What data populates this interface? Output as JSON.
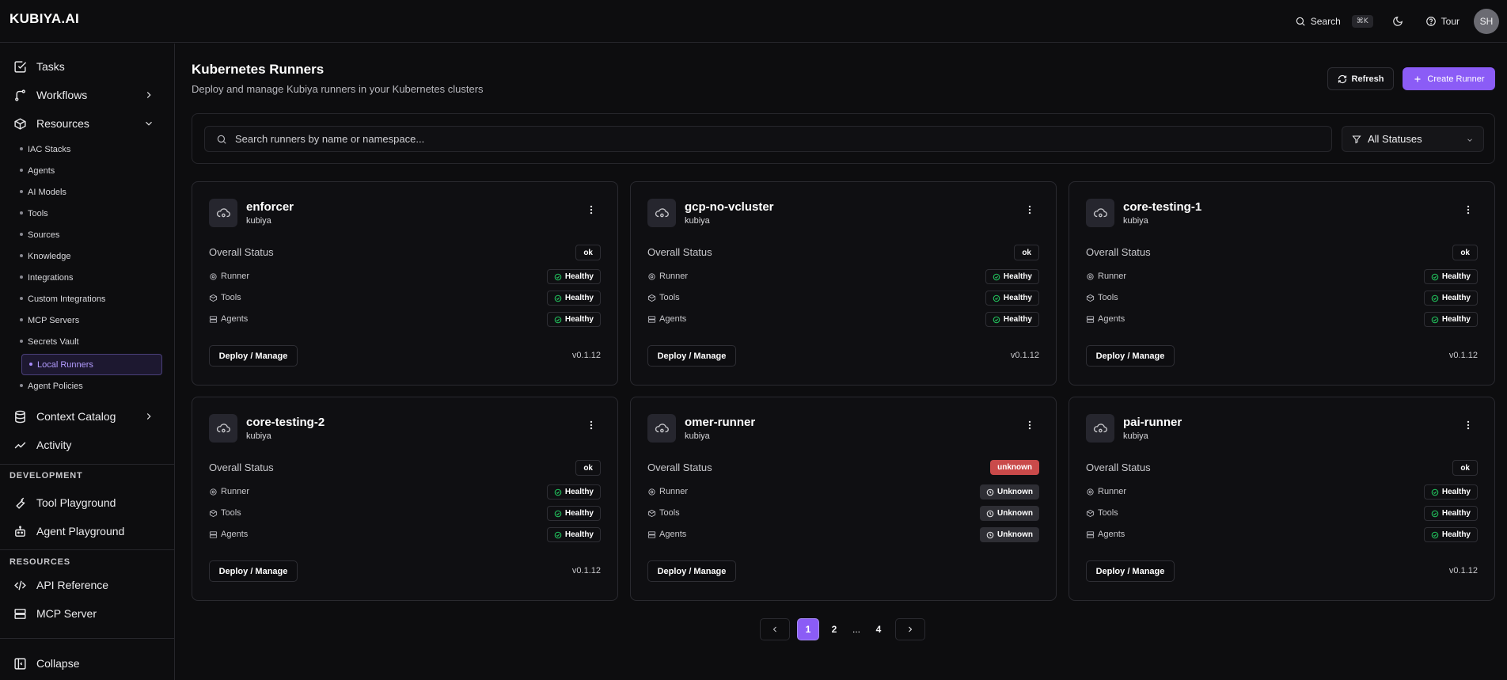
{
  "app": {
    "logo": "KUBIYA.AI",
    "search_label": "Search",
    "search_shortcut": "⌘K",
    "tour_label": "Tour",
    "avatar_initials": "SH"
  },
  "sidebar": {
    "main": [
      {
        "label": "Tasks"
      },
      {
        "label": "Workflows"
      },
      {
        "label": "Resources"
      }
    ],
    "resources_items": [
      {
        "label": "IAC Stacks"
      },
      {
        "label": "Agents"
      },
      {
        "label": "AI Models"
      },
      {
        "label": "Tools"
      },
      {
        "label": "Sources"
      },
      {
        "label": "Knowledge"
      },
      {
        "label": "Integrations"
      },
      {
        "label": "Custom Integrations"
      },
      {
        "label": "MCP Servers"
      },
      {
        "label": "Secrets Vault"
      },
      {
        "label": "Local Runners"
      },
      {
        "label": "Agent Policies"
      }
    ],
    "context_catalog": "Context Catalog",
    "activity": "Activity",
    "development_label": "DEVELOPMENT",
    "tool_playground": "Tool Playground",
    "agent_playground": "Agent Playground",
    "resources_label": "RESOURCES",
    "api_reference": "API Reference",
    "mcp_server": "MCP Server",
    "collapse": "Collapse"
  },
  "header": {
    "title": "Kubernetes Runners",
    "subtitle": "Deploy and manage Kubiya runners in your Kubernetes clusters",
    "refresh_label": "Refresh",
    "create_label": "Create Runner"
  },
  "filters": {
    "search_placeholder": "Search runners by name or namespace...",
    "status_selected": "All Statuses"
  },
  "labels": {
    "overall_status": "Overall Status",
    "runner": "Runner",
    "tools": "Tools",
    "agents": "Agents",
    "deploy": "Deploy / Manage"
  },
  "runners": [
    {
      "name": "enforcer",
      "namespace": "kubiya",
      "overall": "ok",
      "runner": "Healthy",
      "tools": "Healthy",
      "agents": "Healthy",
      "version": "v0.1.12"
    },
    {
      "name": "gcp-no-vcluster",
      "namespace": "kubiya",
      "overall": "ok",
      "runner": "Healthy",
      "tools": "Healthy",
      "agents": "Healthy",
      "version": "v0.1.12"
    },
    {
      "name": "core-testing-1",
      "namespace": "kubiya",
      "overall": "ok",
      "runner": "Healthy",
      "tools": "Healthy",
      "agents": "Healthy",
      "version": "v0.1.12"
    },
    {
      "name": "core-testing-2",
      "namespace": "kubiya",
      "overall": "ok",
      "runner": "Healthy",
      "tools": "Healthy",
      "agents": "Healthy",
      "version": "v0.1.12"
    },
    {
      "name": "omer-runner",
      "namespace": "kubiya",
      "overall": "unknown",
      "runner": "Unknown",
      "tools": "Unknown",
      "agents": "Unknown",
      "version": ""
    },
    {
      "name": "pai-runner",
      "namespace": "kubiya",
      "overall": "ok",
      "runner": "Healthy",
      "tools": "Healthy",
      "agents": "Healthy",
      "version": "v0.1.12"
    }
  ],
  "pagination": {
    "pages": [
      "1",
      "2",
      "...",
      "4"
    ],
    "current": "1"
  },
  "colors": {
    "accent": "#8b5cf6",
    "healthy": "#22c55e",
    "danger": "#c94a4a",
    "background": "#0d0d0f"
  }
}
